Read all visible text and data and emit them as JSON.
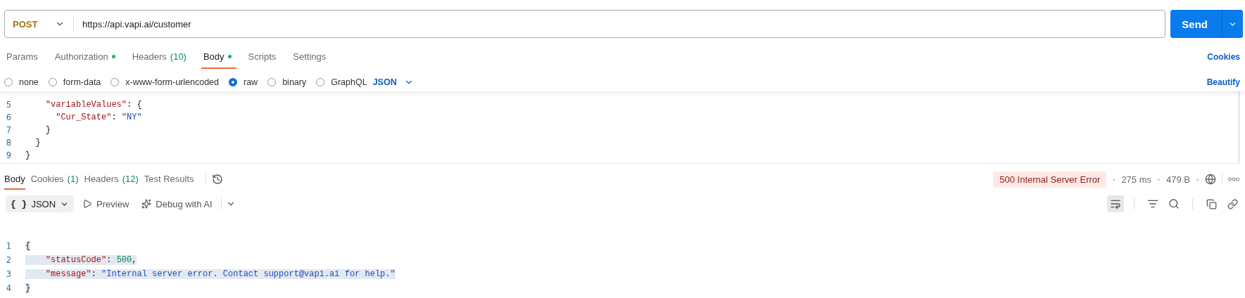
{
  "request": {
    "method": "POST",
    "url": "https://api.vapi.ai/customer",
    "send": "Send"
  },
  "request_tabs": [
    {
      "label": "Params",
      "modified": false,
      "selected": false
    },
    {
      "label": "Authorization",
      "modified": true,
      "selected": false
    },
    {
      "label": "Headers",
      "count": "(10)",
      "modified": false,
      "selected": false
    },
    {
      "label": "Body",
      "modified": true,
      "selected": true
    },
    {
      "label": "Scripts",
      "modified": false,
      "selected": false
    },
    {
      "label": "Settings",
      "modified": false,
      "selected": false
    }
  ],
  "cookies_link": "Cookies",
  "body_types": [
    {
      "label": "none",
      "selected": false
    },
    {
      "label": "form-data",
      "selected": false
    },
    {
      "label": "x-www-form-urlencoded",
      "selected": false
    },
    {
      "label": "raw",
      "selected": true
    },
    {
      "label": "binary",
      "selected": false
    },
    {
      "label": "GraphQL",
      "selected": false
    }
  ],
  "body_format": "JSON",
  "beautify_link": "Beautify",
  "editor_lines": [
    {
      "number": "5",
      "tokens": [
        {
          "kind": "key",
          "text": "    \"variableValues\""
        },
        {
          "kind": "plain",
          "text": ": {"
        }
      ]
    },
    {
      "number": "6",
      "tokens": [
        {
          "kind": "key",
          "text": "      \"Cur_State\""
        },
        {
          "kind": "plain",
          "text": ": "
        },
        {
          "kind": "string",
          "text": "\"NY\""
        }
      ]
    },
    {
      "number": "7",
      "tokens": [
        {
          "kind": "plain",
          "text": "    }"
        }
      ]
    },
    {
      "number": "8",
      "tokens": [
        {
          "kind": "plain",
          "text": "  }"
        }
      ]
    },
    {
      "number": "9",
      "tokens": [
        {
          "kind": "plain",
          "text": "}"
        }
      ]
    }
  ],
  "response_tabs": [
    {
      "label": "Body",
      "selected": true
    },
    {
      "label": "Cookies",
      "count": "(1)",
      "selected": false
    },
    {
      "label": "Headers",
      "count": "(12)",
      "selected": false
    },
    {
      "label": "Test Results",
      "selected": false
    }
  ],
  "status": {
    "label": "500 Internal Server Error",
    "time": "275 ms",
    "size": "479 B"
  },
  "response_toolbar": {
    "format_icon": "{ }",
    "format": "JSON",
    "preview": "Preview",
    "debug": "Debug with AI",
    "word_wrap_on": true
  },
  "response_lines": [
    {
      "number": "1",
      "selected": true,
      "tokens": [
        {
          "kind": "plain",
          "text": "{"
        }
      ]
    },
    {
      "number": "2",
      "selected": true,
      "tokens": [
        {
          "kind": "key",
          "text": "    \"statusCode\""
        },
        {
          "kind": "plain",
          "text": ": "
        },
        {
          "kind": "number",
          "text": "500"
        },
        {
          "kind": "plain",
          "text": ","
        }
      ]
    },
    {
      "number": "3",
      "selected": true,
      "tokens": [
        {
          "kind": "key",
          "text": "    \"message\""
        },
        {
          "kind": "plain",
          "text": ": "
        },
        {
          "kind": "string",
          "text": "\"Internal server error. Contact support@vapi.ai for help.\""
        }
      ]
    },
    {
      "number": "4",
      "selected": true,
      "tokens": [
        {
          "kind": "plain",
          "text": "}"
        }
      ]
    }
  ]
}
